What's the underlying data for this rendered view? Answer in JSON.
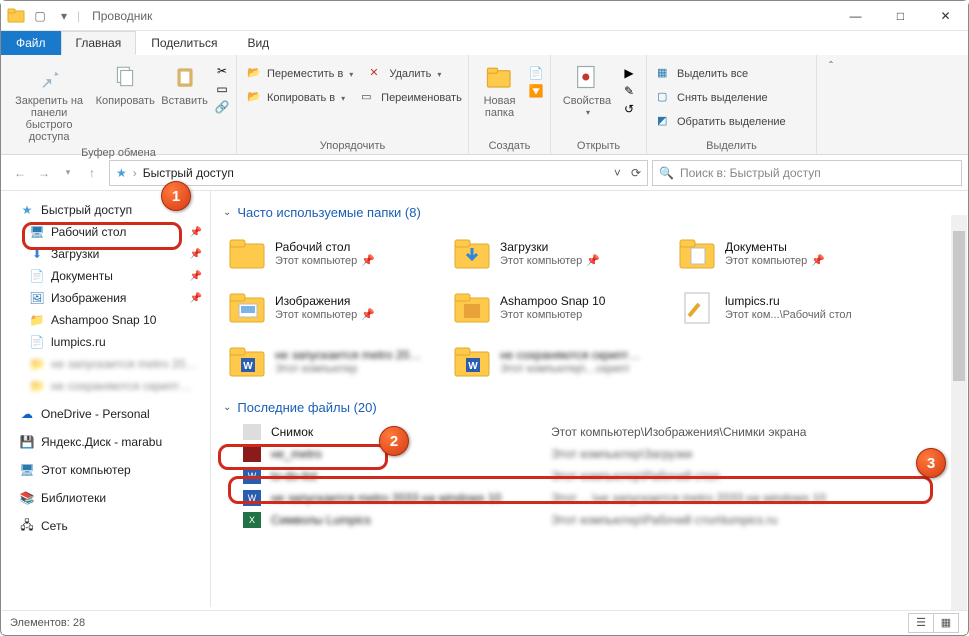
{
  "window": {
    "title": "Проводник",
    "min": "—",
    "max": "□",
    "close": "✕"
  },
  "tabs": {
    "file": "Файл",
    "home": "Главная",
    "share": "Поделиться",
    "view": "Вид"
  },
  "ribbon": {
    "clipboard": {
      "pin": "Закрепить на панели быстрого доступа",
      "copy": "Копировать",
      "paste": "Вставить",
      "label": "Буфер обмена"
    },
    "organize": {
      "moveTo": "Переместить в",
      "copyTo": "Копировать в",
      "delete": "Удалить",
      "rename": "Переименовать",
      "label": "Упорядочить"
    },
    "new": {
      "folder": "Новая папка",
      "label": "Создать"
    },
    "open": {
      "props": "Свойства",
      "label": "Открыть"
    },
    "select": {
      "all": "Выделить все",
      "none": "Снять выделение",
      "invert": "Обратить выделение",
      "label": "Выделить"
    }
  },
  "nav": {
    "location": "Быстрый доступ",
    "searchPlaceholder": "Поиск в: Быстрый доступ"
  },
  "sidebar": {
    "quickAccess": "Быстрый доступ",
    "items": [
      {
        "label": "Рабочий стол",
        "icon": "desktop",
        "pinned": true
      },
      {
        "label": "Загрузки",
        "icon": "downloads",
        "pinned": true
      },
      {
        "label": "Документы",
        "icon": "documents",
        "pinned": true
      },
      {
        "label": "Изображения",
        "icon": "pictures",
        "pinned": true
      },
      {
        "label": "Ashampoo Snap 10",
        "icon": "folder",
        "pinned": false
      },
      {
        "label": "lumpics.ru",
        "icon": "file",
        "pinned": false
      }
    ],
    "onedrive": "OneDrive - Personal",
    "yandex": "Яндекс.Диск - marabu",
    "thispc": "Этот компьютер",
    "libraries": "Библиотеки",
    "network": "Сеть"
  },
  "content": {
    "freqHeader": "Часто используемые папки (8)",
    "tiles": [
      {
        "name": "Рабочий стол",
        "sub": "Этот компьютер",
        "icon": "desktop",
        "pinned": true
      },
      {
        "name": "Загрузки",
        "sub": "Этот компьютер",
        "icon": "downloads",
        "pinned": true
      },
      {
        "name": "Документы",
        "sub": "Этот компьютер",
        "icon": "documents",
        "pinned": true
      },
      {
        "name": "Изображения",
        "sub": "Этот компьютер",
        "icon": "pictures",
        "pinned": true
      },
      {
        "name": "Ashampoo Snap 10",
        "sub": "Этот компьютер",
        "icon": "folder",
        "pinned": false
      },
      {
        "name": "lumpics.ru",
        "sub": "Этот ком...\\Рабочий стол",
        "icon": "file",
        "pinned": false
      }
    ],
    "recentHeader": "Последние файлы (20)",
    "recent": [
      {
        "name": "Снимок",
        "path": "Этот компьютер\\Изображения\\Снимки экрана",
        "icon": "image",
        "highlight": true
      }
    ]
  },
  "status": {
    "count": "Элементов: 28"
  }
}
